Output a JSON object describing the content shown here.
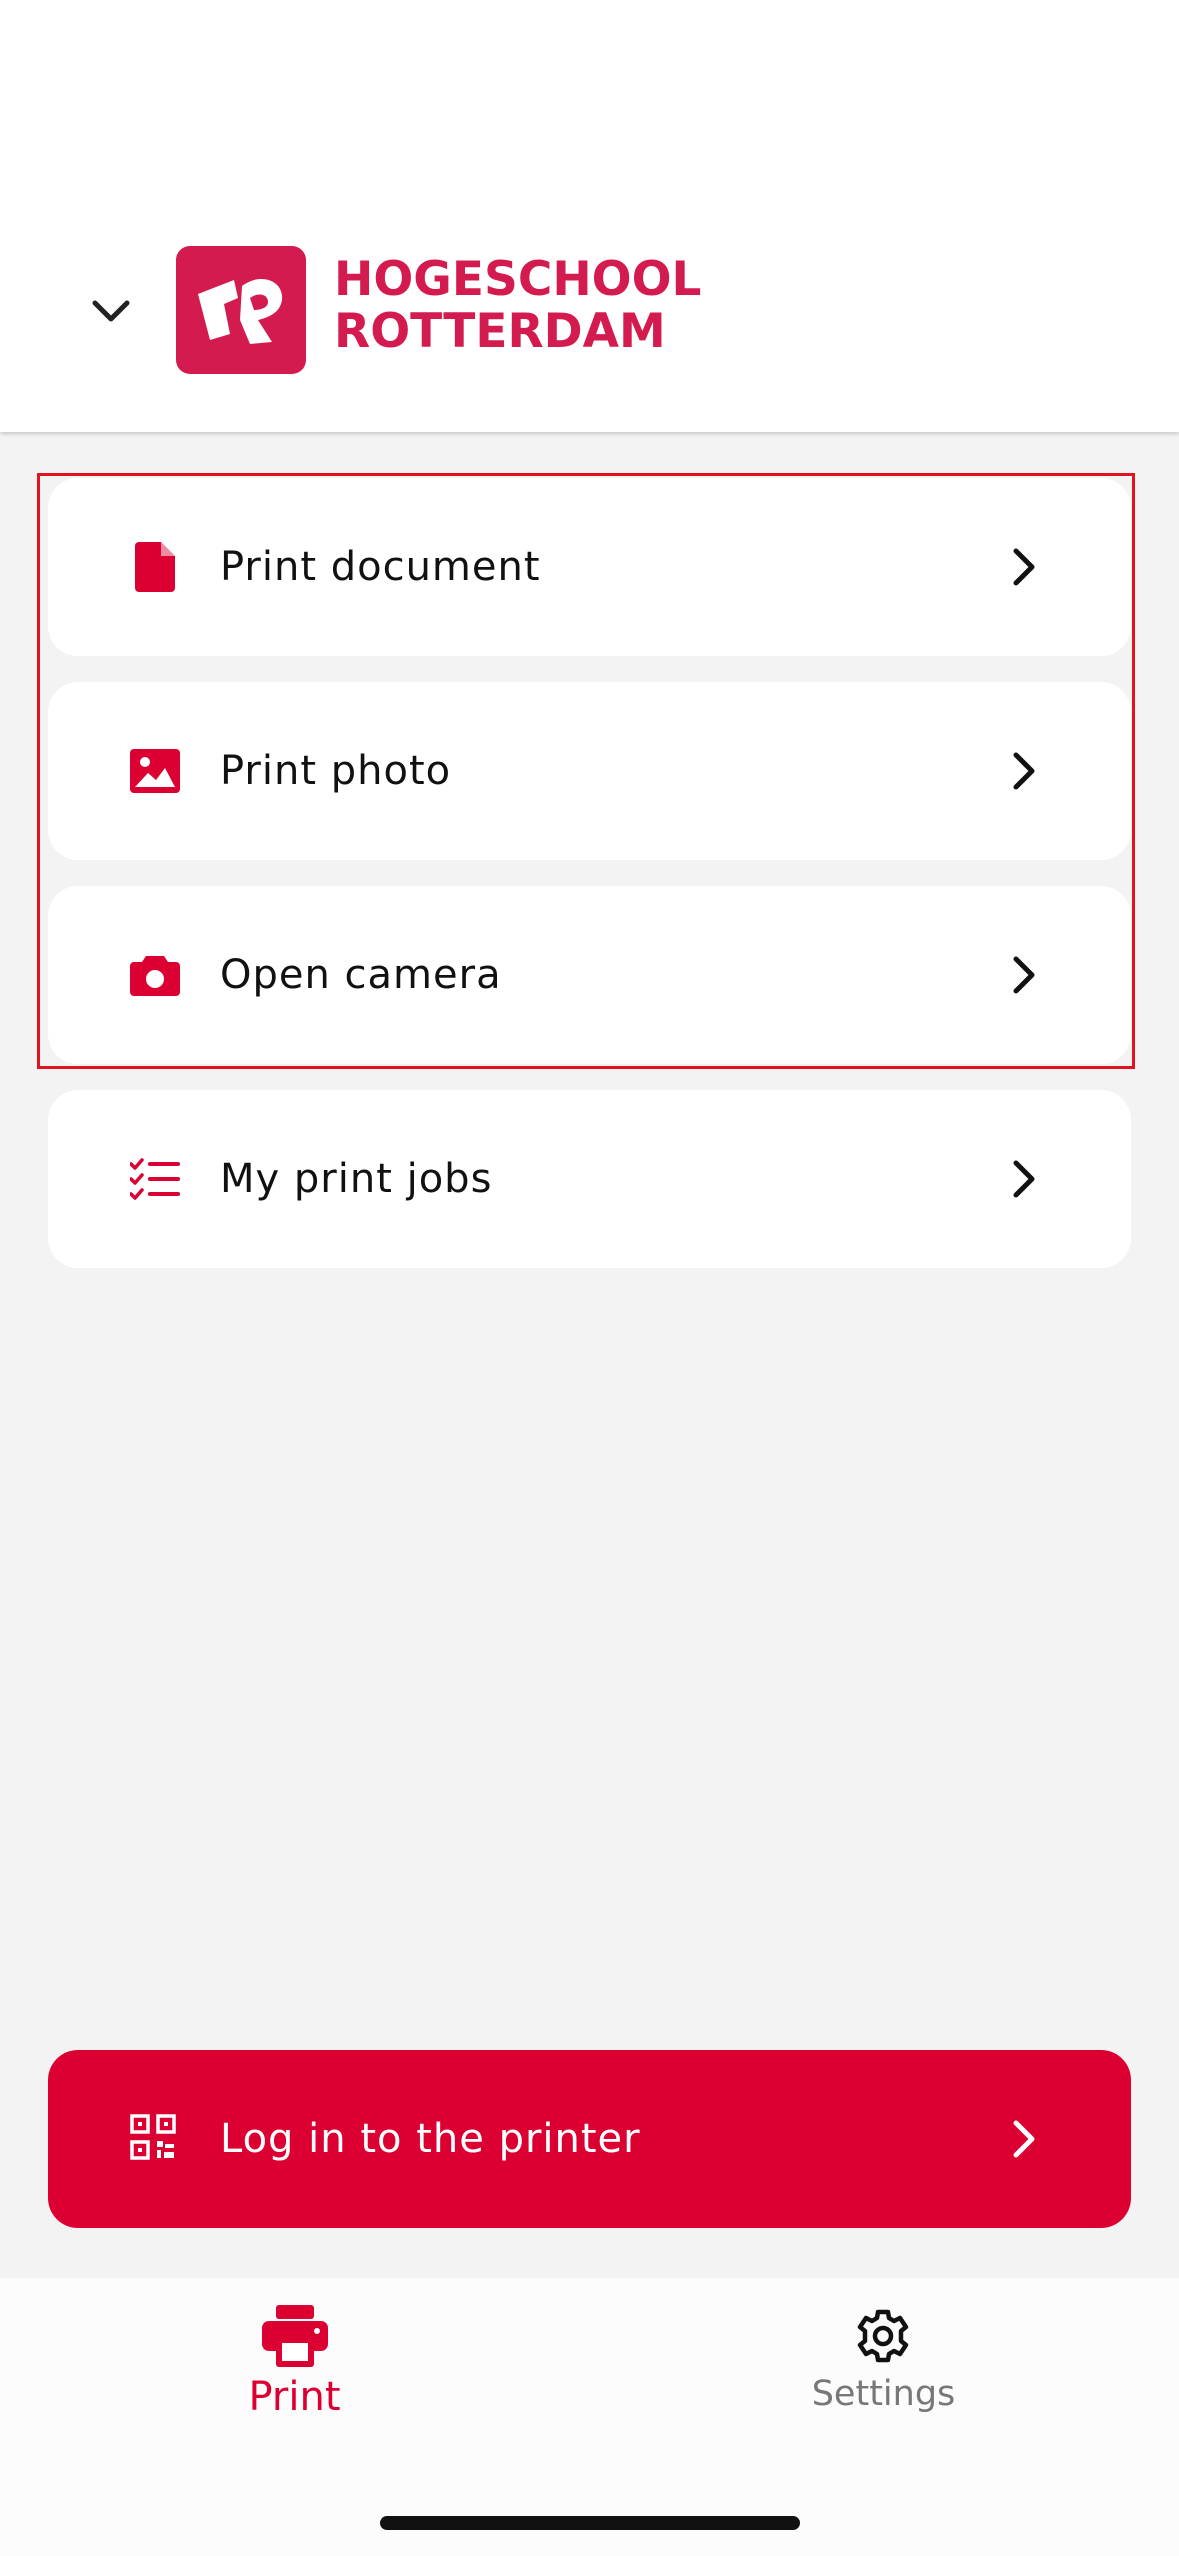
{
  "header": {
    "logo_line1": "HOGESCHOOL",
    "logo_line2": "ROTTERDAM",
    "collapse_icon": "chevron-down-icon"
  },
  "menu": [
    {
      "label": "Print document",
      "icon": "document-icon"
    },
    {
      "label": "Print photo",
      "icon": "image-icon"
    },
    {
      "label": "Open camera",
      "icon": "camera-icon"
    },
    {
      "label": "My print jobs",
      "icon": "checklist-icon"
    }
  ],
  "login": {
    "label": "Log in to the printer",
    "icon": "qr-code-icon"
  },
  "tabs": [
    {
      "label": "Print",
      "icon": "printer-icon",
      "active": true
    },
    {
      "label": "Settings",
      "icon": "gear-icon",
      "active": false
    }
  ],
  "colors": {
    "accent": "#dc0032",
    "logo": "#d41b4f",
    "background": "#f3f3f3",
    "highlight_border": "#e0141e"
  }
}
